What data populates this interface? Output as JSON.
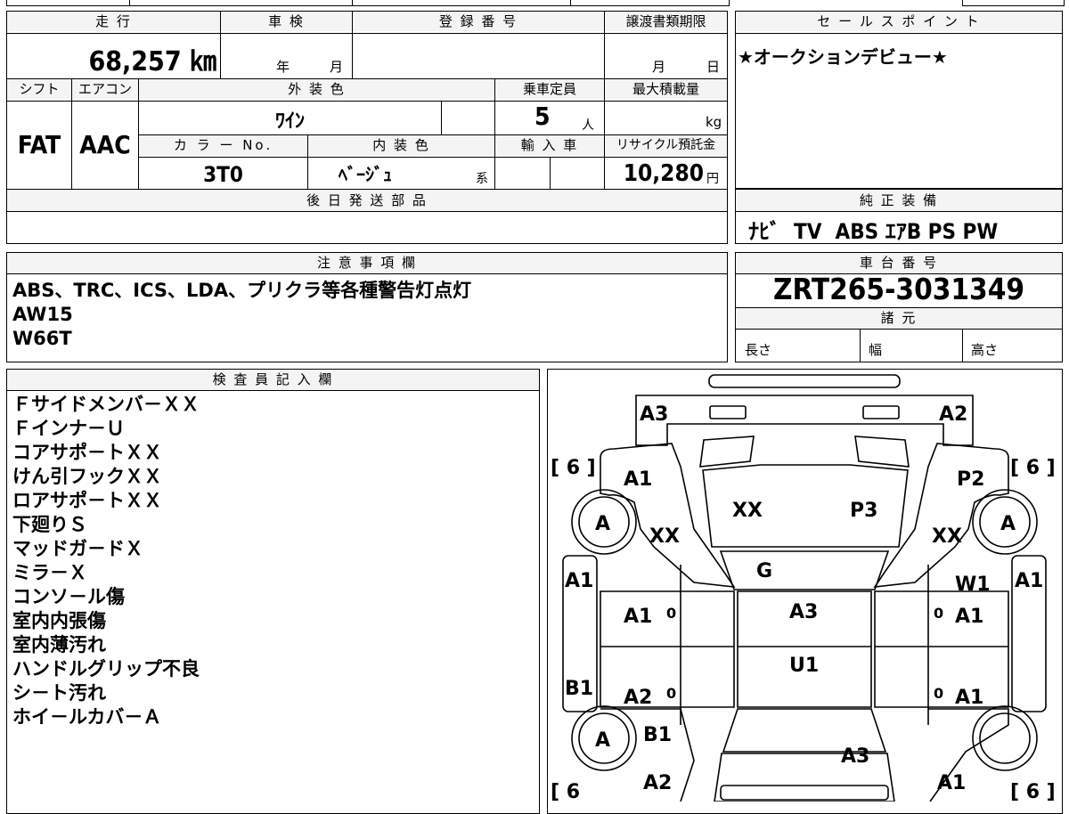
{
  "vehicle": {
    "mileage_label": "走 行",
    "mileage": "68,257 ㎞",
    "inspection_label": "車 検",
    "inspection_year_unit": "年",
    "inspection_month_unit": "月",
    "registration_label": "登 録 番 号",
    "transfer_deadline_label": "譲渡書類期限",
    "transfer_month_unit": "月",
    "transfer_day_unit": "日",
    "shift_label": "シフト",
    "shift": "FAT",
    "ac_label": "エアコン",
    "ac": "AAC",
    "exterior_color_label": "外 装 色",
    "exterior_color": "ﾜｲﾝ",
    "capacity_label": "乗車定員",
    "capacity": "5",
    "capacity_unit": "人",
    "max_load_label": "最大積載量",
    "max_load_unit": "kg",
    "color_no_label": "カ ラ ー No.",
    "color_no": "3T0",
    "interior_color_label": "内 装 色",
    "interior_color": "ﾍﾞｰｼﾞｭ",
    "interior_color_suffix": "系",
    "import_label": "輸 入 車",
    "recycle_label": "リサイクル預託金",
    "recycle_fee": "10,280",
    "recycle_unit": "円"
  },
  "later_parts": {
    "label": "後 日 発 送 部 品"
  },
  "sales_point": {
    "label": "セ ー ル ス ポ イ ン ト",
    "text": "★オークションデビュー★"
  },
  "equipment": {
    "label": "純 正 装 備",
    "text": "ﾅﾋﾞ  TV  ABS ｴｱB PS PW"
  },
  "notes": {
    "label": "注 意 事 項 欄",
    "lines": [
      "ABS、TRC、ICS、LDA、プリクラ等各種警告灯点灯",
      "AW15",
      "W66T"
    ]
  },
  "chassis": {
    "label": "車 台 番 号",
    "number": "ZRT265-3031349",
    "specs_label": "諸 元",
    "length_label": "長さ",
    "width_label": "幅",
    "height_label": "高さ"
  },
  "inspector": {
    "label": "検 査 員 記 入 欄",
    "lines": [
      "Ｆサイドメンバ－ＸＸ",
      "Ｆインナ－Ｕ",
      "コアサポ－トＸＸ",
      "けん引フックＸＸ",
      "ロアサポ－トＸＸ",
      "下廻りＳ",
      "マッドガ－ドＸ",
      "ミラ－Ｘ",
      "コンソ－ル傷",
      "室内内張傷",
      "室内薄汚れ",
      "ハンドルグリップ不良",
      "シ－ト汚れ",
      "ホイ－ルカバ－Ａ"
    ]
  },
  "diagram": {
    "tire_bracket_fl": "[ 6 ]",
    "tire_bracket_fr": "[ 6 ]",
    "tire_bracket_rl": "[ 6",
    "tire_bracket_rr": "[ 6 ]",
    "marks": {
      "front_left_corner": "A3",
      "front_right_corner": "A2",
      "front_left_fender": "A1",
      "front_right_fender": "P2",
      "hood_left": "XX",
      "hood_right": "P3",
      "front_left_wheel": "A",
      "front_right_wheel": "A",
      "left_apron": "XX",
      "right_apron": "XX",
      "windshield": "G",
      "left_pillar": "A1",
      "right_pillar": "A1",
      "right_mirror_area": "W1",
      "front_left_door": "A1",
      "front_right_door": "A1",
      "roof_front": "A3",
      "roof_rear": "U1",
      "left_rocker": "B1",
      "right_rocker": "A1",
      "rear_left_door": "A2",
      "rear_right_door": "A1",
      "rear_left_wheel": "A",
      "rear_left_quarter": "B1",
      "trunk": "A3",
      "rear_left_corner": "A2",
      "rear_right_corner": "A1",
      "door_zero_1": "0",
      "door_zero_2": "0",
      "door_zero_3": "0",
      "door_zero_4": "0"
    }
  }
}
